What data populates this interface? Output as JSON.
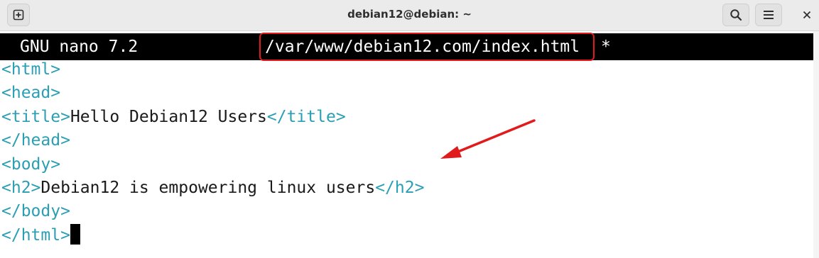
{
  "window": {
    "title": "debian12@debian: ~"
  },
  "icons": {
    "new_tab": "new-tab-icon",
    "search": "search-icon",
    "menu": "hamburger-menu-icon",
    "close": "close-icon"
  },
  "nano": {
    "version": "GNU nano 7.2",
    "filename": "/var/www/debian12.com/index.html",
    "modified": "*"
  },
  "code": {
    "lines": [
      {
        "open": "<html>",
        "text": "",
        "close": ""
      },
      {
        "open": "<head>",
        "text": "",
        "close": ""
      },
      {
        "open": "<title>",
        "text": "Hello Debian12 Users",
        "close": "</title>"
      },
      {
        "open": "</head>",
        "text": "",
        "close": ""
      },
      {
        "open": "<body>",
        "text": "",
        "close": ""
      },
      {
        "open": "<h2>",
        "text": "Debian12 is empowering linux users",
        "close": "</h2>"
      },
      {
        "open": "</body>",
        "text": "",
        "close": ""
      },
      {
        "open": "</html>",
        "text": "",
        "close": ""
      }
    ]
  },
  "colors": {
    "tag": "#2a9fb4",
    "annotation": "#e11b1b",
    "status_bar": "#000000"
  }
}
